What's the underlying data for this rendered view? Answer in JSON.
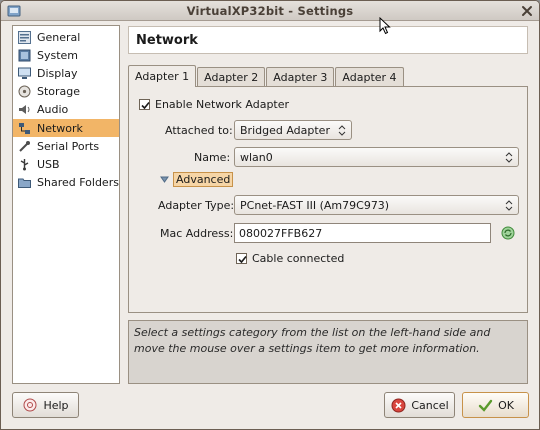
{
  "window": {
    "title": "VirtualXP32bit - Settings"
  },
  "sidebar": {
    "items": [
      {
        "label": "General",
        "icon": "general-icon",
        "active": false
      },
      {
        "label": "System",
        "icon": "system-icon",
        "active": false
      },
      {
        "label": "Display",
        "icon": "display-icon",
        "active": false
      },
      {
        "label": "Storage",
        "icon": "storage-icon",
        "active": false
      },
      {
        "label": "Audio",
        "icon": "audio-icon",
        "active": false
      },
      {
        "label": "Network",
        "icon": "network-icon",
        "active": true
      },
      {
        "label": "Serial Ports",
        "icon": "serial-ports-icon",
        "active": false
      },
      {
        "label": "USB",
        "icon": "usb-icon",
        "active": false
      },
      {
        "label": "Shared Folders",
        "icon": "shared-folders-icon",
        "active": false
      }
    ]
  },
  "header": {
    "title": "Network"
  },
  "tabs": [
    {
      "label": "Adapter 1",
      "active": true
    },
    {
      "label": "Adapter 2",
      "active": false
    },
    {
      "label": "Adapter 3",
      "active": false
    },
    {
      "label": "Adapter 4",
      "active": false
    }
  ],
  "adapter": {
    "enable_label": "Enable Network Adapter",
    "enable_checked": true,
    "attached_label": "Attached to:",
    "attached_value": "Bridged Adapter",
    "name_label": "Name:",
    "name_value": "wlan0",
    "advanced_label": "Advanced",
    "type_label": "Adapter Type:",
    "type_value": "PCnet-FAST III (Am79C973)",
    "mac_label": "Mac Address:",
    "mac_value": "080027FFB627",
    "cable_label": "Cable connected",
    "cable_checked": true
  },
  "info": {
    "text": "Select a settings category from the list on the left-hand side and move the mouse over a settings item to get more information."
  },
  "buttons": {
    "help": "Help",
    "cancel": "Cancel",
    "ok": "OK"
  },
  "colors": {
    "selection": "#f2b567",
    "window_bg": "#efebe7",
    "info_bg": "#d8d4cf"
  }
}
